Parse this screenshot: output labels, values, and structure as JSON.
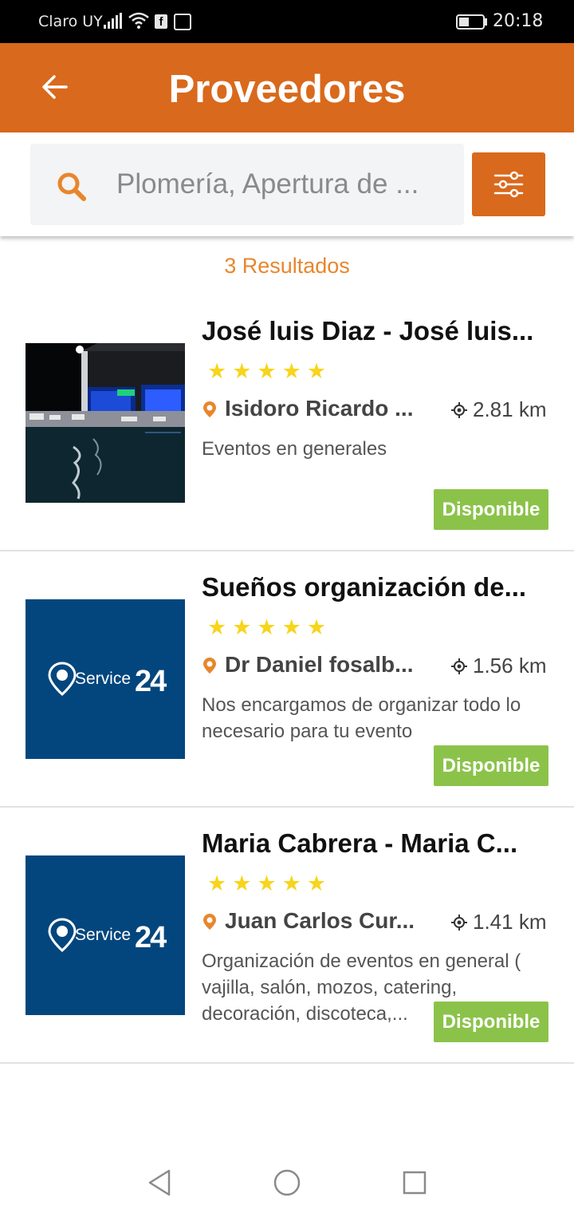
{
  "status_bar": {
    "carrier": "Claro UY",
    "time": "20:18"
  },
  "app_bar": {
    "title": "Proveedores"
  },
  "search": {
    "placeholder": "Plomería, Apertura de ..."
  },
  "results": {
    "count_label": "3 Resultados"
  },
  "providers": [
    {
      "name": "José luis Diaz - José luis...",
      "rating": 5,
      "address": "Isidoro Ricardo ...",
      "distance": "2.81 km",
      "description": "Eventos en generales",
      "status": "Disponible"
    },
    {
      "name": "Sueños organización de...",
      "rating": 5,
      "address": "Dr Daniel fosalb...",
      "distance": "1.56 km",
      "description": "Nos encargamos de organizar todo lo necesario para tu evento",
      "status": "Disponible",
      "logo_text": "Service",
      "logo_num": "24"
    },
    {
      "name": "Maria Cabrera - Maria C...",
      "rating": 5,
      "address": "Juan Carlos Cur...",
      "distance": "1.41 km",
      "description": "Organización de eventos en general ( vajilla, salón, mozos, catering, decoración, discoteca,...",
      "status": "Disponible",
      "logo_text": "Service",
      "logo_num": "24"
    }
  ],
  "colors": {
    "primary": "#d9691c",
    "accent_text": "#e8862c",
    "available": "#8bc34a",
    "stars": "#f7d51d",
    "logo_bg": "#03467e"
  },
  "icons": [
    "back-arrow-icon",
    "search-icon",
    "filter-sliders-icon",
    "map-pin-icon",
    "location-target-icon",
    "nav-back-icon",
    "nav-home-icon",
    "nav-recents-icon"
  ]
}
